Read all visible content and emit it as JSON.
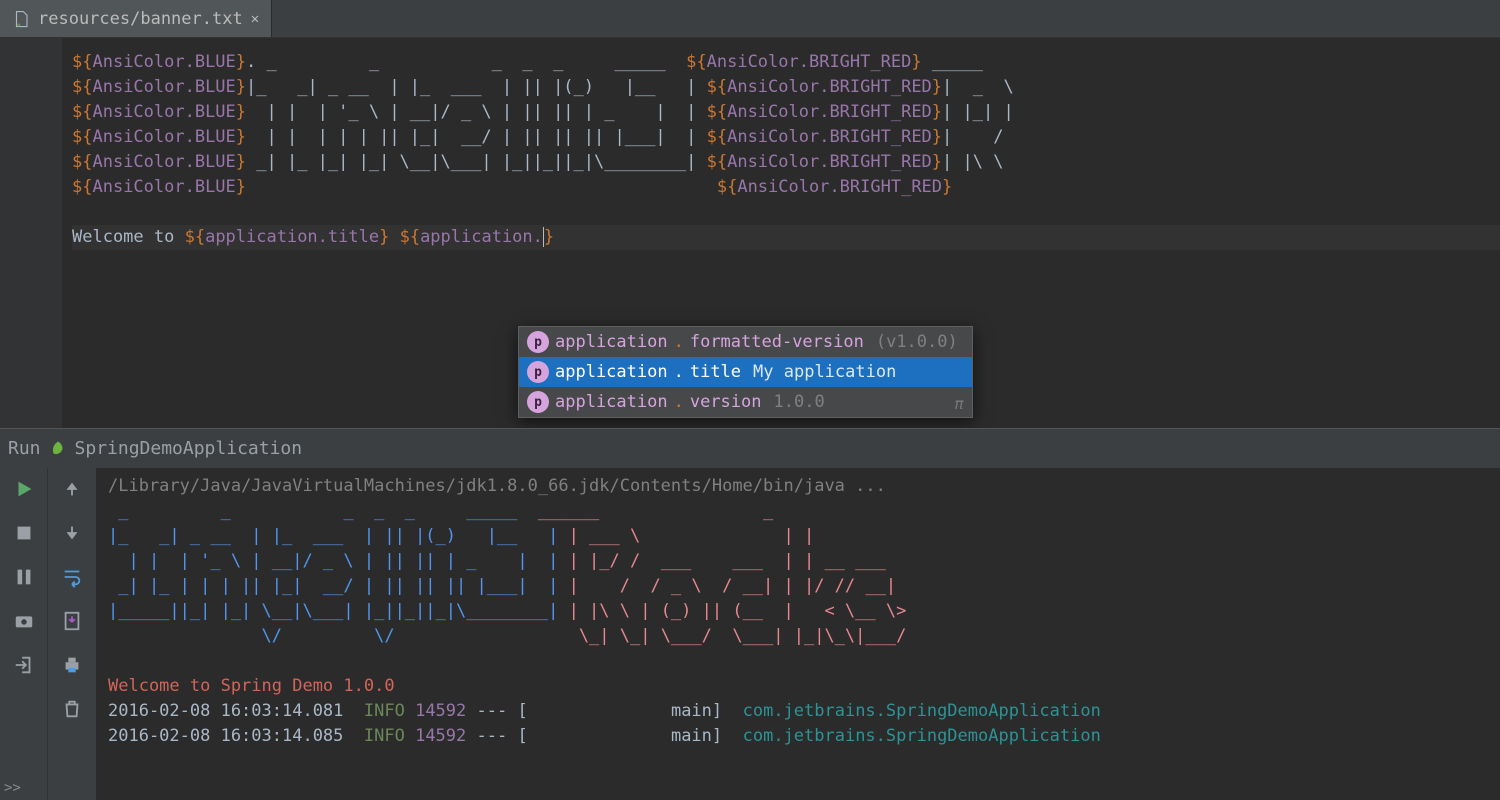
{
  "tab": {
    "label": "resources/banner.txt"
  },
  "editor": {
    "color_blue": "AnsiColor.BLUE",
    "color_red": "AnsiColor.BRIGHT_RED",
    "ascii_left": [
      ". _         _           _  _  _     _____  ",
      "|_   _| _ __  | |_  ___  | || |(_)   |__   | ",
      "  | |  | '_ \\ | __|/ _ \\ | || || | _    |  | ",
      "  | |  | | | || |_|  __/ | || || || |___|  | ",
      " _| |_ |_| |_| \\__|\\___| |_||_||_|\\________| ",
      "                                              "
    ],
    "ascii_right_tail": [
      " _____   ",
      "|  _  \\  ",
      "| |_| |  ",
      "|    /   ",
      "| |\\ \\   ",
      "         "
    ],
    "welcome_prefix": "Welcome to ",
    "prop1": "application.title",
    "prop2_prefix": "application.",
    "caret": "|"
  },
  "completion": {
    "items": [
      {
        "key": "application",
        "sub": "formatted-version",
        "val": "(v1.0.0)"
      },
      {
        "key": "application",
        "sub": "title",
        "val": "My application"
      },
      {
        "key": "application",
        "sub": "version",
        "val": "1.0.0"
      }
    ],
    "selected_index": 1,
    "pi": "π"
  },
  "run": {
    "label": "Run",
    "config": "SpringDemoApplication"
  },
  "console": {
    "path": "/Library/Java/JavaVirtualMachines/jdk1.8.0_66.jdk/Contents/Home/bin/java ...",
    "ascii_blue": [
      " _         _           _  _  _     _____  ",
      "|_   _| _ __  | |_  ___  | || |(_)   |__   | ",
      "  | |  | '_ \\ | __|/ _ \\ | || || | _    |  | ",
      " _| |_ | | | || |_|  __/ | || || || |___|  | ",
      "|_____||_| |_| \\__|\\___| |_||_||_|\\________| ",
      "               \\/         \\/                  "
    ],
    "ascii_red": [
      "______                _          ",
      "| ___ \\              | |         ",
      "| |_/ /  ___    ___  | | __ ___  ",
      "|    /  / _ \\  / __| | |/ // __| ",
      "| |\\ \\ | (_) || (__  |   < \\__ \\>",
      "\\_| \\_| \\___/  \\___| |_|\\_\\|___/ "
    ],
    "welcome": "Welcome to Spring Demo 1.0.0",
    "log_rows": [
      {
        "ts": "2016-02-08 16:03:14.081",
        "level": "INFO",
        "pid": "14592",
        "sep": "--- [",
        "thread": "main]",
        "cls": "com.jetbrains.SpringDemoApplication"
      },
      {
        "ts": "2016-02-08 16:03:14.085",
        "level": "INFO",
        "pid": "14592",
        "sep": "--- [",
        "thread": "main]",
        "cls": "com.jetbrains.SpringDemoApplication"
      }
    ]
  }
}
